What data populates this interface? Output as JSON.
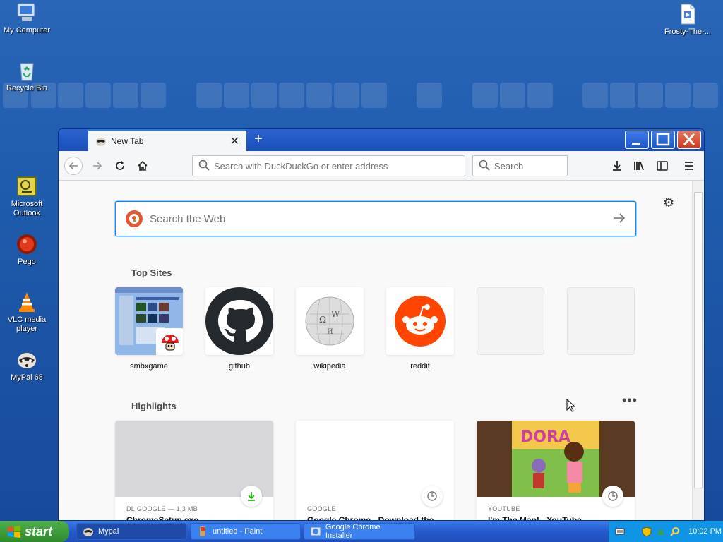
{
  "desktop": {
    "icons": [
      {
        "label": "My Computer"
      },
      {
        "label": "Recycle Bin"
      },
      {
        "label": "Microsoft\nOutlook"
      },
      {
        "label": "Pego"
      },
      {
        "label": "VLC media\nplayer"
      },
      {
        "label": "MyPal 68"
      },
      {
        "label": "Frosty-The-..."
      }
    ]
  },
  "browser": {
    "tab_title": "New Tab",
    "url_placeholder": "Search with DuckDuckGo or enter address",
    "search_placeholder": "Search",
    "web_search_placeholder": "Search the Web",
    "top_sites_title": "Top Sites",
    "top_sites": [
      {
        "label": "smbxgame"
      },
      {
        "label": "github"
      },
      {
        "label": "wikipedia"
      },
      {
        "label": "reddit"
      },
      {
        "label": ""
      },
      {
        "label": ""
      }
    ],
    "highlights_title": "Highlights",
    "highlights": [
      {
        "source": "DL.GOOGLE — 1.3 MB",
        "title": "ChromeSetup.exe"
      },
      {
        "source": "GOOGLE",
        "title": "Google Chrome - Download the"
      },
      {
        "source": "YOUTUBE",
        "title": "I'm The Map! - YouTube"
      }
    ]
  },
  "taskbar": {
    "start_label": "start",
    "tasks": [
      {
        "label": "Mypal"
      },
      {
        "label": "untitled - Paint"
      },
      {
        "label": "Google Chrome Installer"
      }
    ],
    "clock": "10:02 PM"
  },
  "colors": {
    "accent": "#0a84ff",
    "reddit": "#ff4500",
    "ddg": "#de5833"
  }
}
